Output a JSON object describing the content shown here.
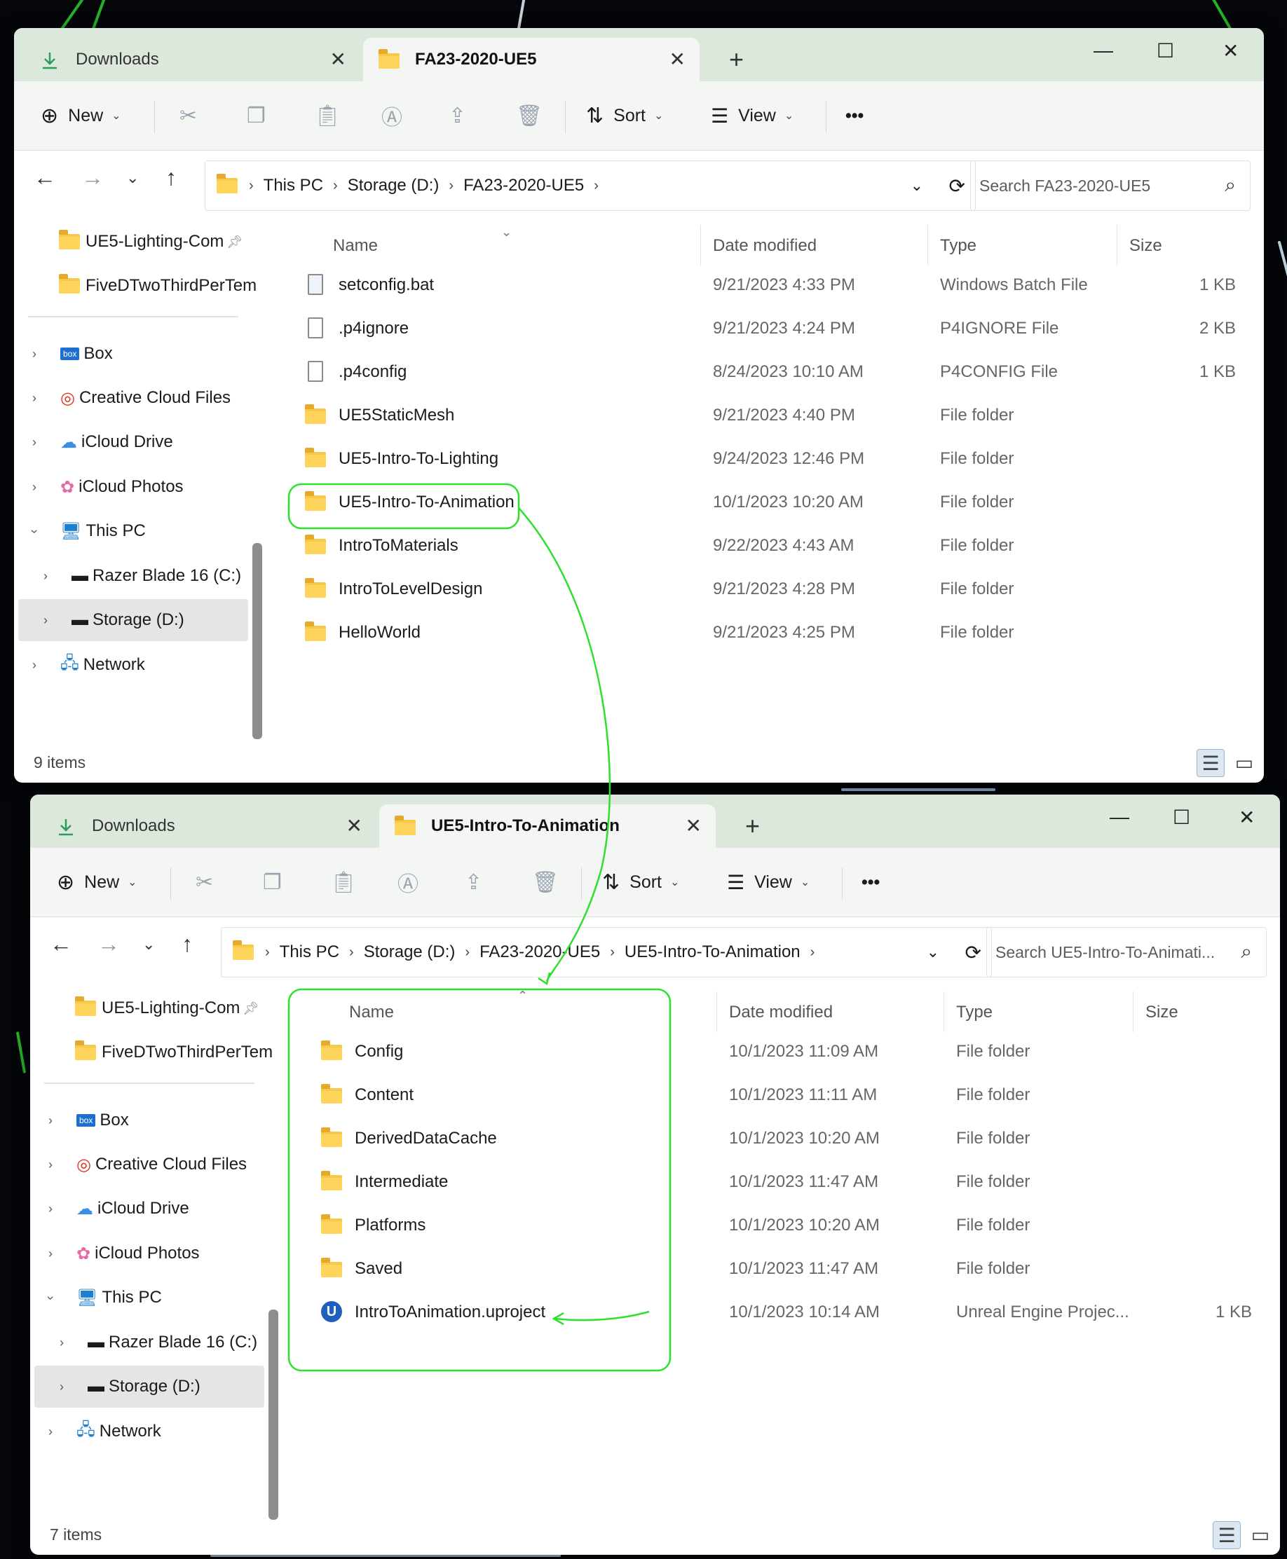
{
  "colors": {
    "annotation": "#2ee02e",
    "accent": "#0067c0",
    "titlebar": "#dce8dc",
    "folder": "#f7c948"
  },
  "window_top": {
    "tabs": [
      {
        "label": "Downloads",
        "icon": "download-icon"
      },
      {
        "label": "FA23-2020-UE5",
        "icon": "folder-icon"
      }
    ],
    "toolbar": {
      "new_label": "New",
      "sort_label": "Sort",
      "view_label": "View",
      "more_label": "•••"
    },
    "breadcrumb": [
      "This PC",
      "Storage (D:)",
      "FA23-2020-UE5"
    ],
    "search_placeholder": "Search FA23-2020-UE5",
    "nav": {
      "pinned": [
        "UE5-Lighting-Com",
        "FiveDTwoThirdPerTem"
      ],
      "items": [
        "Box",
        "Creative Cloud Files",
        "iCloud Drive",
        "iCloud Photos",
        "This PC",
        "Razer Blade 16 (C:)",
        "Storage (D:)",
        "Network"
      ]
    },
    "columns": [
      "Name",
      "Date modified",
      "Type",
      "Size"
    ],
    "rows": [
      {
        "name": "setconfig.bat",
        "date": "9/21/2023 4:33 PM",
        "type": "Windows Batch File",
        "size": "1 KB",
        "icon": "batch-file-icon"
      },
      {
        "name": ".p4ignore",
        "date": "9/21/2023 4:24 PM",
        "type": "P4IGNORE File",
        "size": "2 KB",
        "icon": "file-icon"
      },
      {
        "name": ".p4config",
        "date": "8/24/2023 10:10 AM",
        "type": "P4CONFIG File",
        "size": "1 KB",
        "icon": "file-icon"
      },
      {
        "name": "UE5StaticMesh",
        "date": "9/21/2023 4:40 PM",
        "type": "File folder",
        "size": "",
        "icon": "folder-icon"
      },
      {
        "name": "UE5-Intro-To-Lighting",
        "date": "9/24/2023 12:46 PM",
        "type": "File folder",
        "size": "",
        "icon": "folder-icon"
      },
      {
        "name": "UE5-Intro-To-Animation",
        "date": "10/1/2023 10:20 AM",
        "type": "File folder",
        "size": "",
        "icon": "folder-icon"
      },
      {
        "name": "IntroToMaterials",
        "date": "9/22/2023 4:43 AM",
        "type": "File folder",
        "size": "",
        "icon": "folder-icon"
      },
      {
        "name": "IntroToLevelDesign",
        "date": "9/21/2023 4:28 PM",
        "type": "File folder",
        "size": "",
        "icon": "folder-icon"
      },
      {
        "name": "HelloWorld",
        "date": "9/21/2023 4:25 PM",
        "type": "File folder",
        "size": "",
        "icon": "folder-icon"
      }
    ],
    "status": "9 items"
  },
  "window_bottom": {
    "tabs": [
      {
        "label": "Downloads",
        "icon": "download-icon"
      },
      {
        "label": "UE5-Intro-To-Animation",
        "icon": "folder-icon"
      }
    ],
    "toolbar": {
      "new_label": "New",
      "sort_label": "Sort",
      "view_label": "View",
      "more_label": "•••"
    },
    "breadcrumb": [
      "This PC",
      "Storage (D:)",
      "FA23-2020-UE5",
      "UE5-Intro-To-Animation"
    ],
    "search_placeholder": "Search UE5-Intro-To-Animati...",
    "nav": {
      "pinned": [
        "UE5-Lighting-Com",
        "FiveDTwoThirdPerTem"
      ],
      "items": [
        "Box",
        "Creative Cloud Files",
        "iCloud Drive",
        "iCloud Photos",
        "This PC",
        "Razer Blade 16 (C:)",
        "Storage (D:)",
        "Network"
      ]
    },
    "columns": [
      "Name",
      "Date modified",
      "Type",
      "Size"
    ],
    "rows": [
      {
        "name": "Config",
        "date": "10/1/2023 11:09 AM",
        "type": "File folder",
        "size": "",
        "icon": "folder-icon"
      },
      {
        "name": "Content",
        "date": "10/1/2023 11:11 AM",
        "type": "File folder",
        "size": "",
        "icon": "folder-icon"
      },
      {
        "name": "DerivedDataCache",
        "date": "10/1/2023 10:20 AM",
        "type": "File folder",
        "size": "",
        "icon": "folder-icon"
      },
      {
        "name": "Intermediate",
        "date": "10/1/2023 11:47 AM",
        "type": "File folder",
        "size": "",
        "icon": "folder-icon"
      },
      {
        "name": "Platforms",
        "date": "10/1/2023 10:20 AM",
        "type": "File folder",
        "size": "",
        "icon": "folder-icon"
      },
      {
        "name": "Saved",
        "date": "10/1/2023 11:47 AM",
        "type": "File folder",
        "size": "",
        "icon": "folder-icon"
      },
      {
        "name": "IntroToAnimation.uproject",
        "date": "10/1/2023 10:14 AM",
        "type": "Unreal Engine Projec...",
        "size": "1 KB",
        "icon": "unreal-engine-icon"
      }
    ],
    "status": "7 items"
  }
}
